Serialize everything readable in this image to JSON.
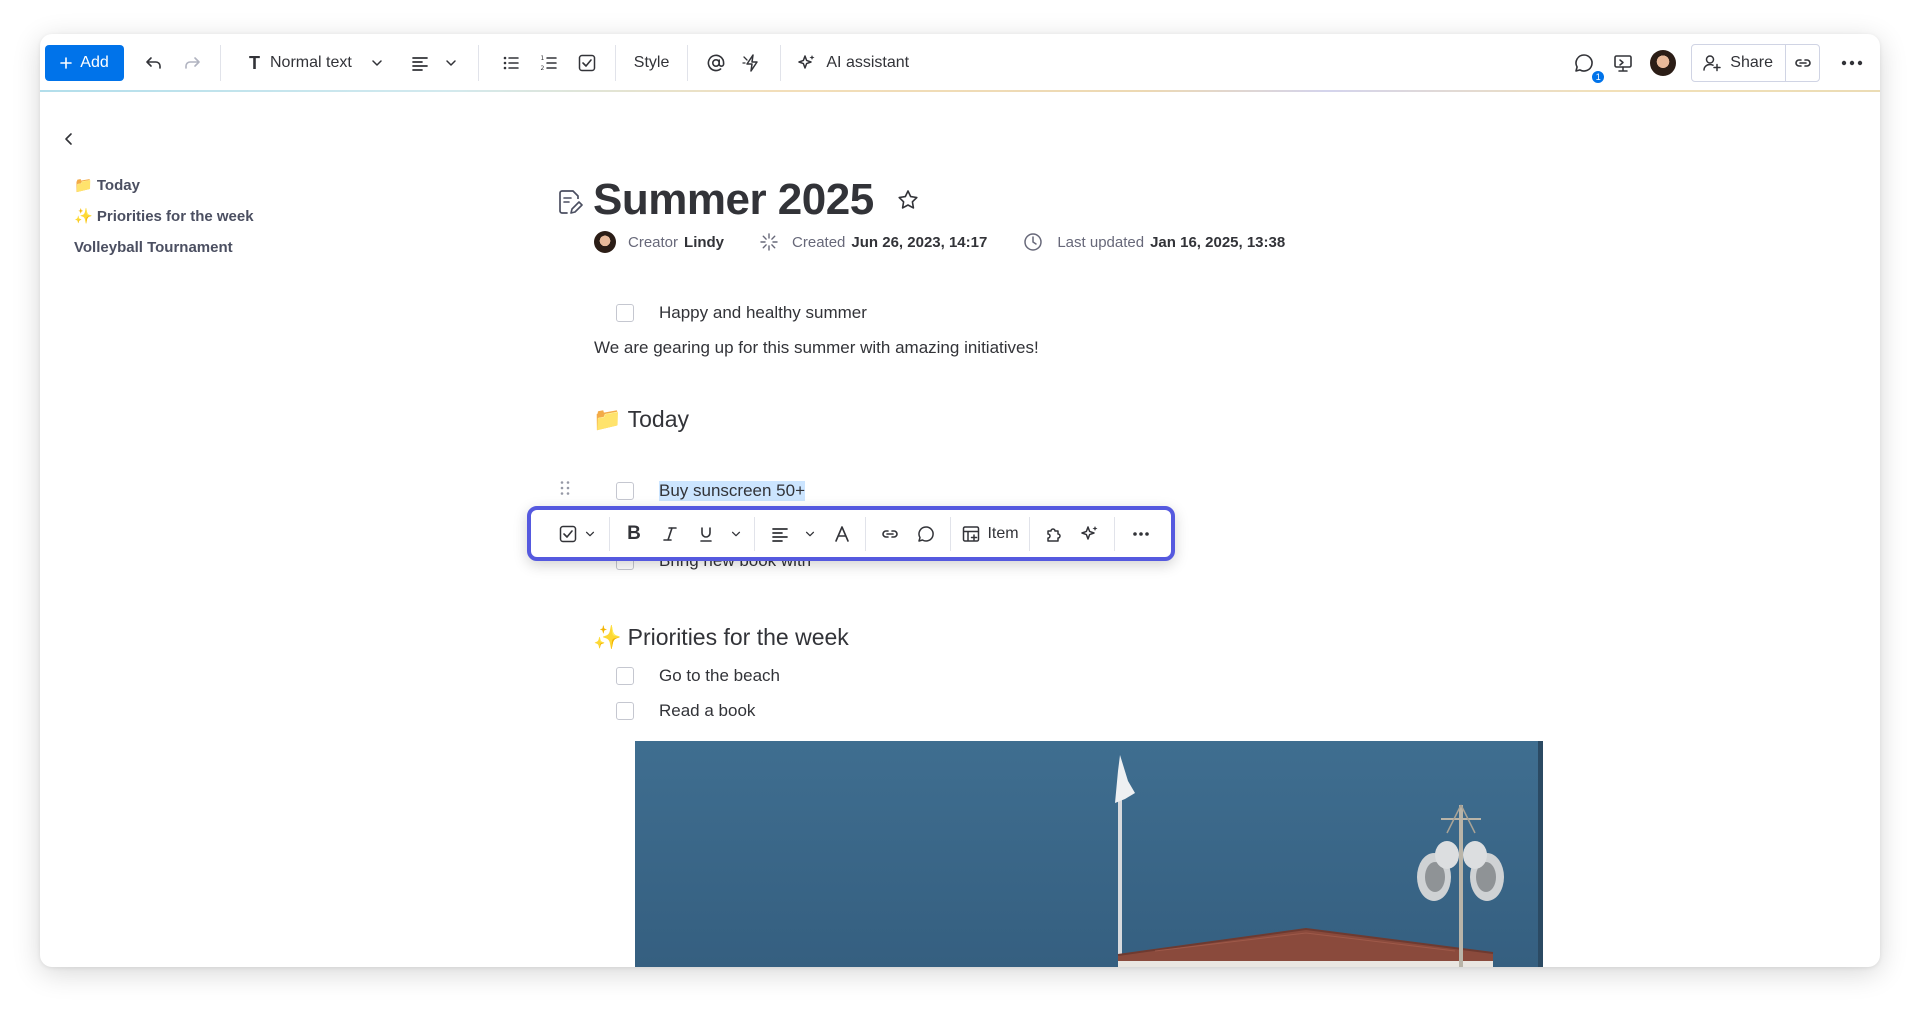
{
  "toolbar": {
    "add_label": "Add",
    "text_style_label": "Normal text",
    "style_label": "Style",
    "ai_label": "AI assistant",
    "share_label": "Share",
    "notification_count": "1"
  },
  "sidebar": {
    "items": [
      {
        "emoji": "📁",
        "label": "Today"
      },
      {
        "emoji": "✨",
        "label": "Priorities for the week"
      },
      {
        "emoji": "",
        "label": "Volleyball Tournament"
      }
    ]
  },
  "doc": {
    "title": "Summer 2025",
    "creator_label": "Creator",
    "creator_name": "Lindy",
    "created_label": "Created",
    "created_value": "Jun 26, 2023, 14:17",
    "updated_label": "Last updated",
    "updated_value": "Jan 16, 2025, 13:38",
    "intro_check": "Happy and healthy summer",
    "intro_text": "We are gearing up for this summer with amazing initiatives!",
    "section1": {
      "emoji": "📁",
      "title": "Today"
    },
    "today_items": [
      "Buy sunscreen 50+",
      "Bring new book with"
    ],
    "section2": {
      "emoji": "✨",
      "title": "Priorities for the week"
    },
    "priority_items": [
      "Go to the beach",
      "Read a book"
    ]
  },
  "format_toolbar": {
    "item_label": "Item"
  },
  "colors": {
    "primary": "#0073ea",
    "focus_outline": "#5559df",
    "selection": "#cce5ff",
    "text": "#323338"
  }
}
